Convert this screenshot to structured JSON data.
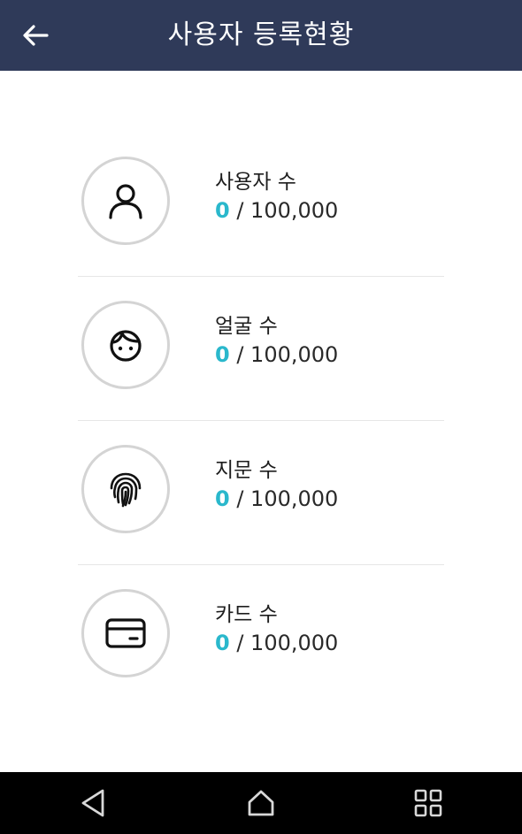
{
  "header": {
    "title": "사용자 등록현황",
    "back_icon": "arrow-left-icon"
  },
  "stats": [
    {
      "icon": "user-icon",
      "label": "사용자 수",
      "count": "0",
      "separator": " / ",
      "max": "100,000"
    },
    {
      "icon": "face-icon",
      "label": "얼굴 수",
      "count": "0",
      "separator": " / ",
      "max": "100,000"
    },
    {
      "icon": "fingerprint-icon",
      "label": "지문 수",
      "count": "0",
      "separator": " / ",
      "max": "100,000"
    },
    {
      "icon": "card-icon",
      "label": "카드 수",
      "count": "0",
      "separator": " / ",
      "max": "100,000"
    }
  ],
  "navbar": {
    "back": "triangle-back-icon",
    "home": "home-icon",
    "recents": "grid-recents-icon"
  },
  "colors": {
    "header_bg": "#2f3a59",
    "accent": "#2ab8cc",
    "navbar_bg": "#000000"
  }
}
